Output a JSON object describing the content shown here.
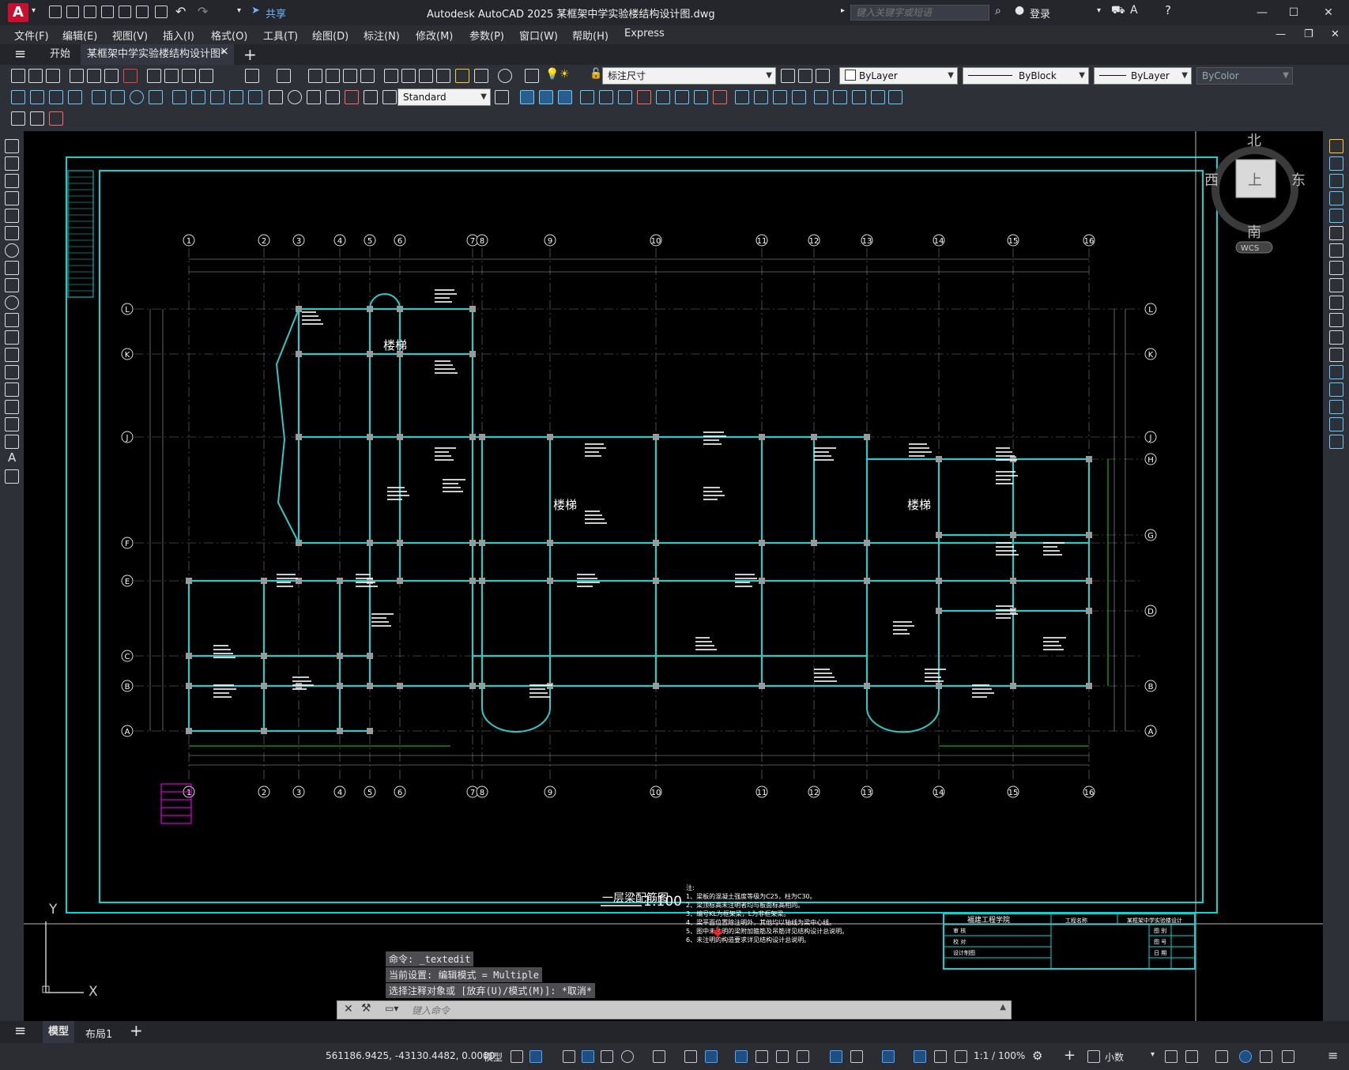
{
  "app": {
    "logo_letter": "A",
    "share_label": "共享",
    "window_title": "Autodesk AutoCAD 2025    某框架中学实验楼结构设计图.dwg",
    "search_placeholder": "键入关键字或短语",
    "login_label": "登录"
  },
  "menu": [
    "文件(F)",
    "编辑(E)",
    "视图(V)",
    "插入(I)",
    "格式(O)",
    "工具(T)",
    "绘图(D)",
    "标注(N)",
    "修改(M)",
    "参数(P)",
    "窗口(W)",
    "帮助(H)",
    "Express"
  ],
  "tabs": {
    "start": "开始",
    "active": "某框架中学实验楼结构设计图*",
    "close": "×",
    "add": "+"
  },
  "toolbar": {
    "layer_name": "标注尺寸",
    "color": "ByLayer",
    "linetype": "ByBlock",
    "lineweight": "ByLayer",
    "plotstyle": "ByColor",
    "dimstyle": "Standard"
  },
  "viewcube": {
    "north": "北",
    "south": "南",
    "east": "东",
    "west": "西",
    "face": "上",
    "wcs": "WCS"
  },
  "drawing": {
    "grid_top": [
      "1",
      "2",
      "3",
      "4",
      "5",
      "6",
      "7",
      "8",
      "9",
      "10",
      "11",
      "12",
      "13",
      "14",
      "15",
      "16"
    ],
    "grid_left": [
      "L",
      "K",
      "J",
      "F",
      "E",
      "C",
      "B",
      "A"
    ],
    "grid_right": [
      "L",
      "K",
      "J",
      "H",
      "G",
      "D",
      "B",
      "A"
    ],
    "stair_label": "楼梯",
    "plan_title": "一层梁配筋图",
    "plan_scale": "1:100",
    "notes_header": "注:",
    "notes": [
      "1、梁板的混凝土强度等级为C25，柱为C30。",
      "2、梁顶标高未注明者均与板面标高相同。",
      "3、编号KL为框架梁，L为非框架梁。",
      "4、梁平面位置除注明外，其他均以轴线为梁中心线。",
      "5、图中未注明的梁附加箍筋及吊筋详见结构设计总说明。",
      "6、未注明的构造要求详见结构设计总说明。"
    ],
    "title_block_school": "福建工程学院",
    "title_block_project": "工程名称",
    "title_block_design": "某框架中学实验楼设计",
    "title_block_rows": [
      "审 核",
      "校 对",
      "设计制图"
    ],
    "title_block_right": [
      "图 别",
      "图 号",
      "日 期"
    ],
    "axis_y": "Y",
    "axis_x": "X"
  },
  "command": {
    "history": [
      "命令: _textedit",
      "当前设置: 编辑模式 = Multiple",
      "选择注释对象或 [放弃(U)/模式(M)]: *取消*"
    ],
    "placeholder": "键入命令"
  },
  "layout_tabs": [
    "模型",
    "布局1"
  ],
  "status": {
    "coords": "561186.9425, -43130.4482, 0.0000",
    "model": "模型",
    "scale": "1:1 / 100%",
    "units": "小数"
  },
  "colors": {
    "drawing_bg": "#000000",
    "frame": "#00d8d8",
    "beam": "#2ec8c8",
    "column": "#9a9a9a",
    "text": "#ffffff",
    "dim": "#22cc22",
    "magenta": "#ff00ff"
  }
}
